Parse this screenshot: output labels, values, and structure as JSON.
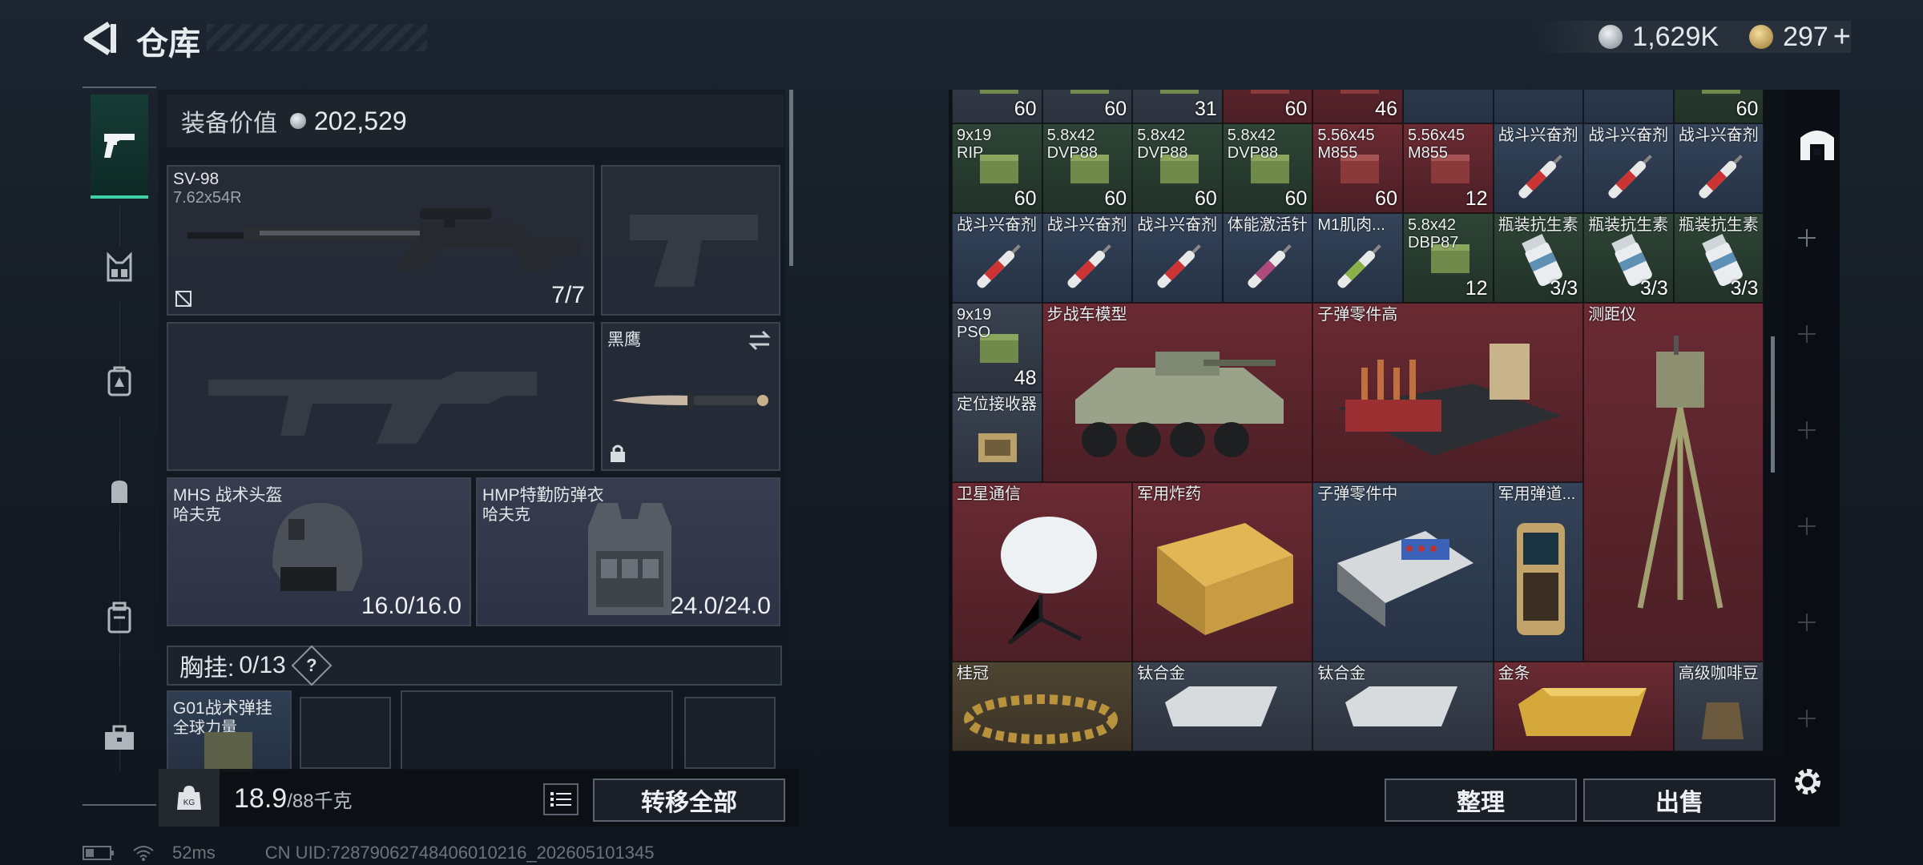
{
  "header": {
    "title": "仓库",
    "silver_amount": "1,629K",
    "gold_amount": "297",
    "gold_plus": "+"
  },
  "left": {
    "equip_value_label": "装备价值",
    "equip_value": "202,529",
    "primary": {
      "name": "SV-98",
      "caliber": "7.62x54R",
      "ammo": "7/7"
    },
    "melee": {
      "name": "黑鹰"
    },
    "helmet": {
      "name": "MHS 战术头盔",
      "brand": "哈夫克",
      "durability": "16.0/16.0"
    },
    "armor": {
      "name": "HMP特勤防弹衣",
      "brand": "哈夫克",
      "durability": "24.0/24.0"
    },
    "vest": {
      "label": "胸挂:",
      "slots": "0/13",
      "help": "?"
    },
    "chest_rig": {
      "name": "G01战术弹挂",
      "brand": "全球力量"
    },
    "weight_current": "18.9",
    "weight_max": "/88千克",
    "transfer_all": "转移全部"
  },
  "grid": {
    "row0": [
      "60",
      "60",
      "31",
      "60",
      "46",
      "",
      "",
      "",
      "60"
    ],
    "row1": [
      {
        "label": "9x19\nRIP",
        "count": "60"
      },
      {
        "label": "5.8x42\nDVP88",
        "count": "60"
      },
      {
        "label": "5.8x42\nDVP88",
        "count": "60"
      },
      {
        "label": "5.8x42\nDVP88",
        "count": "60"
      },
      {
        "label": "5.56x45\nM855",
        "count": "60"
      },
      {
        "label": "5.56x45\nM855",
        "count": "12"
      },
      {
        "label": "战斗兴奋剂",
        "count": ""
      },
      {
        "label": "战斗兴奋剂",
        "count": ""
      },
      {
        "label": "战斗兴奋剂",
        "count": ""
      }
    ],
    "row2": [
      {
        "label": "战斗兴奋剂",
        "count": ""
      },
      {
        "label": "战斗兴奋剂",
        "count": ""
      },
      {
        "label": "战斗兴奋剂",
        "count": ""
      },
      {
        "label": "体能激活针",
        "count": ""
      },
      {
        "label": "M1肌肉...",
        "count": ""
      },
      {
        "label": "5.8x42\nDBP87",
        "count": "12"
      },
      {
        "label": "瓶装抗生素",
        "count": "3/3"
      },
      {
        "label": "瓶装抗生素",
        "count": "3/3"
      },
      {
        "label": "瓶装抗生素",
        "count": "3/3"
      }
    ],
    "big": {
      "ammo_ps": {
        "label": "9x19\nPSO",
        "count": "48"
      },
      "locator": "定位接收器",
      "ifv_model": "步战车模型",
      "bullet_parts_high": "子弹零件高",
      "rangefinder": "测距仪",
      "satcom": "卫星通信",
      "explosive": "军用炸药",
      "bullet_parts_mid": "子弹零件中",
      "ballistic": "军用弹道...",
      "laurel": "桂冠",
      "titanium1": "钛合金",
      "titanium2": "钛合金",
      "gold_bar": "金条",
      "coffee": "高级咖啡豆"
    }
  },
  "buttons": {
    "sort": "整理",
    "sell": "出售"
  },
  "status": {
    "ping": "52ms",
    "uid": "CN UID:7287906274840601​0216_202605101345"
  },
  "colors": {
    "accent": "#3fd2a9",
    "red_tile": "#6a2a33",
    "blue_tile": "#344358"
  }
}
